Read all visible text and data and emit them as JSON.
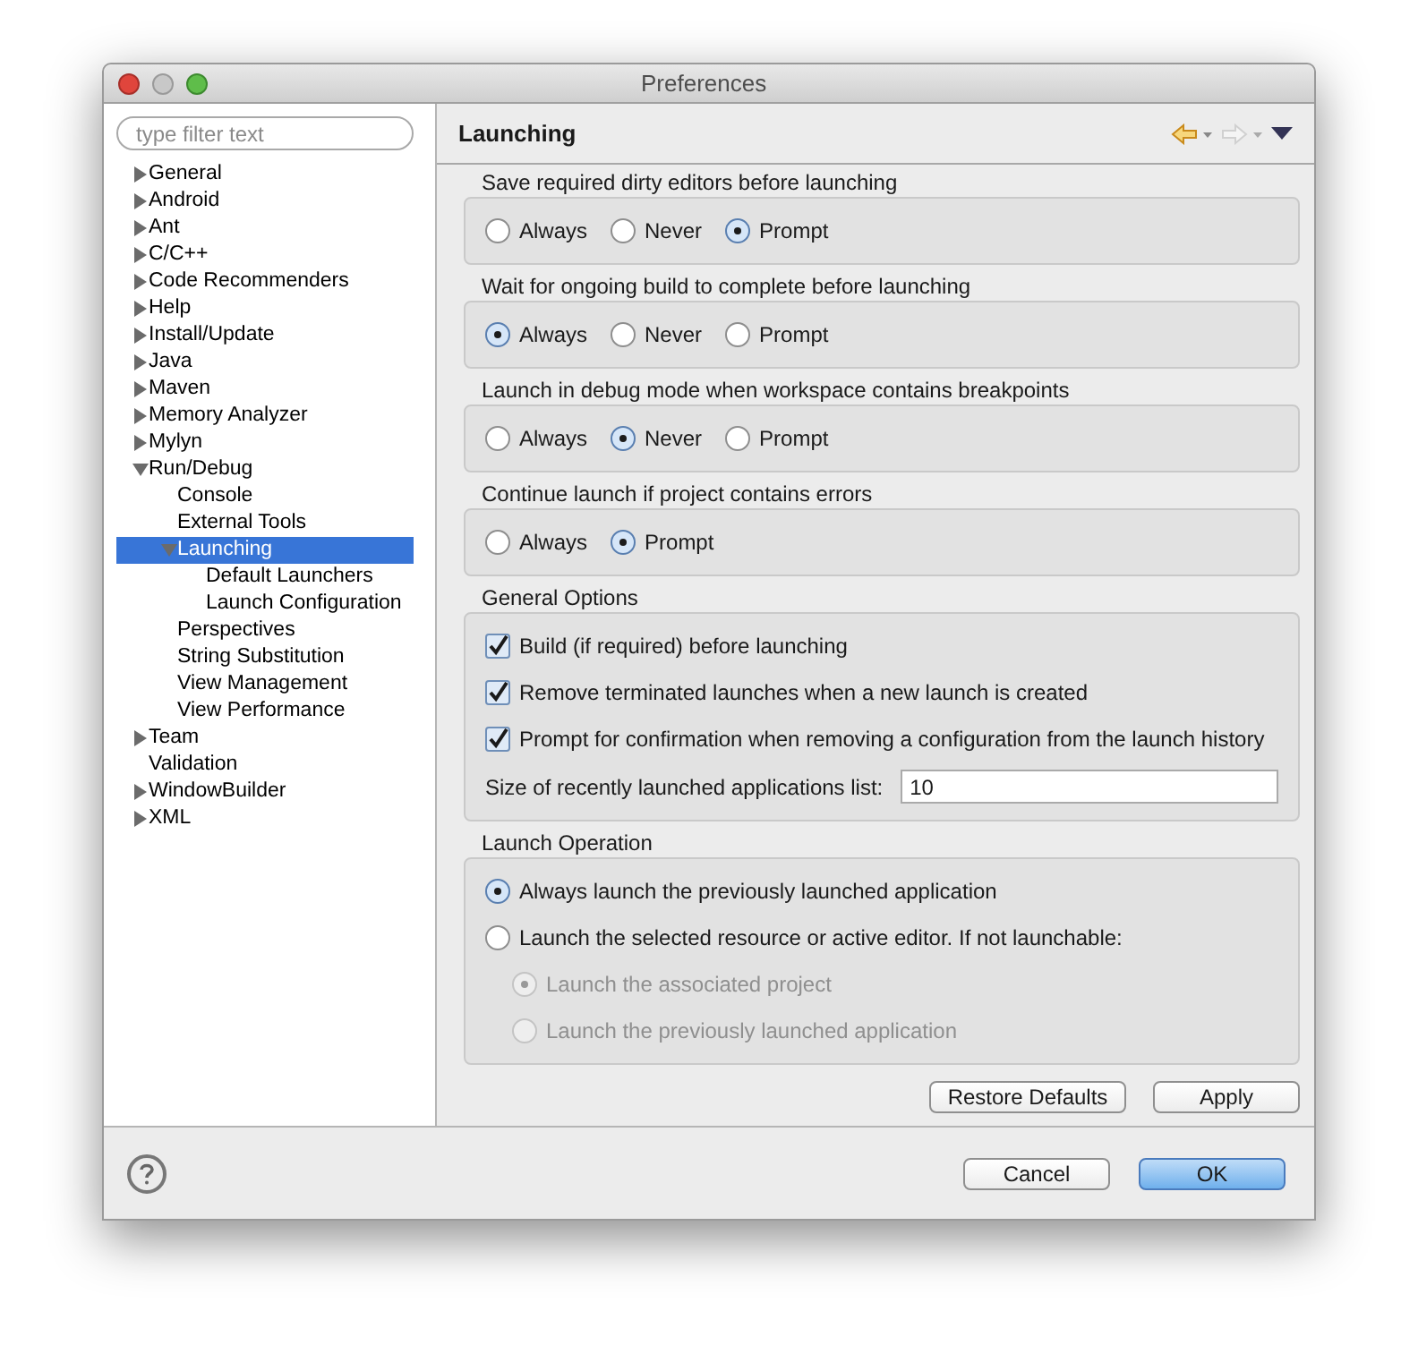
{
  "window": {
    "title": "Preferences"
  },
  "filter": {
    "placeholder": "type filter text"
  },
  "tree": [
    {
      "label": "General",
      "kind": "group",
      "expanded": false,
      "selected": false
    },
    {
      "label": "Android",
      "kind": "group",
      "expanded": false,
      "selected": false
    },
    {
      "label": "Ant",
      "kind": "group",
      "expanded": false,
      "selected": false
    },
    {
      "label": "C/C++",
      "kind": "group",
      "expanded": false,
      "selected": false
    },
    {
      "label": "Code Recommenders",
      "kind": "group",
      "expanded": false,
      "selected": false
    },
    {
      "label": "Help",
      "kind": "group",
      "expanded": false,
      "selected": false
    },
    {
      "label": "Install/Update",
      "kind": "group",
      "expanded": false,
      "selected": false
    },
    {
      "label": "Java",
      "kind": "group",
      "expanded": false,
      "selected": false
    },
    {
      "label": "Maven",
      "kind": "group",
      "expanded": false,
      "selected": false
    },
    {
      "label": "Memory Analyzer",
      "kind": "group",
      "expanded": false,
      "selected": false
    },
    {
      "label": "Mylyn",
      "kind": "group",
      "expanded": false,
      "selected": false
    },
    {
      "label": "Run/Debug",
      "kind": "group",
      "expanded": true,
      "selected": false,
      "children": [
        {
          "label": "Console",
          "kind": "leaf",
          "selected": false
        },
        {
          "label": "External Tools",
          "kind": "leaf",
          "selected": false
        },
        {
          "label": "Launching",
          "kind": "group",
          "expanded": true,
          "selected": true,
          "children": [
            {
              "label": "Default Launchers",
              "kind": "leaf",
              "selected": false
            },
            {
              "label": "Launch Configuration",
              "kind": "leaf",
              "selected": false
            }
          ]
        },
        {
          "label": "Perspectives",
          "kind": "leaf",
          "selected": false
        },
        {
          "label": "String Substitution",
          "kind": "leaf",
          "selected": false
        },
        {
          "label": "View Management",
          "kind": "leaf",
          "selected": false
        },
        {
          "label": "View Performance",
          "kind": "leaf",
          "selected": false
        }
      ]
    },
    {
      "label": "Team",
      "kind": "group",
      "expanded": false,
      "selected": false
    },
    {
      "label": "Validation",
      "kind": "leaf",
      "selected": false
    },
    {
      "label": "WindowBuilder",
      "kind": "group",
      "expanded": false,
      "selected": false
    },
    {
      "label": "XML",
      "kind": "group",
      "expanded": false,
      "selected": false
    }
  ],
  "page": {
    "title": "Launching"
  },
  "radio_groups": [
    {
      "title": "Save required dirty editors before launching",
      "options": [
        {
          "label": "Always",
          "selected": false
        },
        {
          "label": "Never",
          "selected": false
        },
        {
          "label": "Prompt",
          "selected": true
        }
      ]
    },
    {
      "title": "Wait for ongoing build to complete before launching",
      "options": [
        {
          "label": "Always",
          "selected": true
        },
        {
          "label": "Never",
          "selected": false
        },
        {
          "label": "Prompt",
          "selected": false
        }
      ]
    },
    {
      "title": "Launch in debug mode when workspace contains breakpoints",
      "options": [
        {
          "label": "Always",
          "selected": false
        },
        {
          "label": "Never",
          "selected": true
        },
        {
          "label": "Prompt",
          "selected": false
        }
      ]
    },
    {
      "title": "Continue launch if project contains errors",
      "options": [
        {
          "label": "Always",
          "selected": false
        },
        {
          "label": "Prompt",
          "selected": true
        }
      ]
    }
  ],
  "general_options": {
    "title": "General Options",
    "checkboxes": [
      {
        "label": "Build (if required) before launching",
        "checked": true
      },
      {
        "label": "Remove terminated launches when a new launch is created",
        "checked": true
      },
      {
        "label": "Prompt for confirmation when removing a configuration from the launch history",
        "checked": true
      }
    ],
    "history_size": {
      "label": "Size of recently launched applications list:",
      "value": "10"
    }
  },
  "launch_operation": {
    "title": "Launch Operation",
    "options": [
      {
        "label": "Always launch the previously launched application",
        "selected": true,
        "disabled": false
      },
      {
        "label": "Launch the selected resource or active editor. If not launchable:",
        "selected": false,
        "disabled": false,
        "children": [
          {
            "label": "Launch the associated project",
            "selected": true,
            "disabled": true
          },
          {
            "label": "Launch the previously launched application",
            "selected": false,
            "disabled": true
          }
        ]
      }
    ]
  },
  "page_buttons": [
    "Restore Defaults",
    "Apply"
  ],
  "dialog_buttons": [
    {
      "label": "Cancel",
      "kind": "normal"
    },
    {
      "label": "OK",
      "kind": "default"
    }
  ]
}
